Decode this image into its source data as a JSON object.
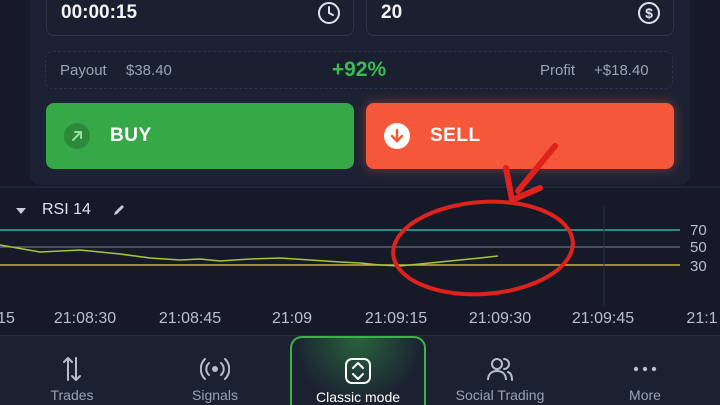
{
  "trade_panel": {
    "time_value": "00:00:15",
    "amount_value": "20",
    "payout_label": "Payout",
    "payout_amount": "$38.40",
    "payout_percent": "+92%",
    "profit_label": "Profit",
    "profit_amount": "+$18.40",
    "buy_label": "BUY",
    "sell_label": "SELL",
    "colors": {
      "buy": "#37a847",
      "sell": "#f4573a",
      "percent": "#3cbb4e"
    }
  },
  "indicator": {
    "name": "RSI 14",
    "levels": [
      "70",
      "50",
      "30"
    ]
  },
  "time_axis": [
    "15",
    "21:08:30",
    "21:08:45",
    "21:09",
    "21:09:15",
    "21:09:30",
    "21:09:45",
    "21:1"
  ],
  "nav": [
    {
      "label": "Trades",
      "icon": "trades-icon"
    },
    {
      "label": "Signals",
      "icon": "signals-icon"
    },
    {
      "label": "Classic mode",
      "icon": "classic-mode-icon",
      "active": true
    },
    {
      "label": "Social Trading",
      "icon": "social-trading-icon"
    },
    {
      "label": "More",
      "icon": "more-icon"
    }
  ],
  "annotation_color": "#e0221d"
}
